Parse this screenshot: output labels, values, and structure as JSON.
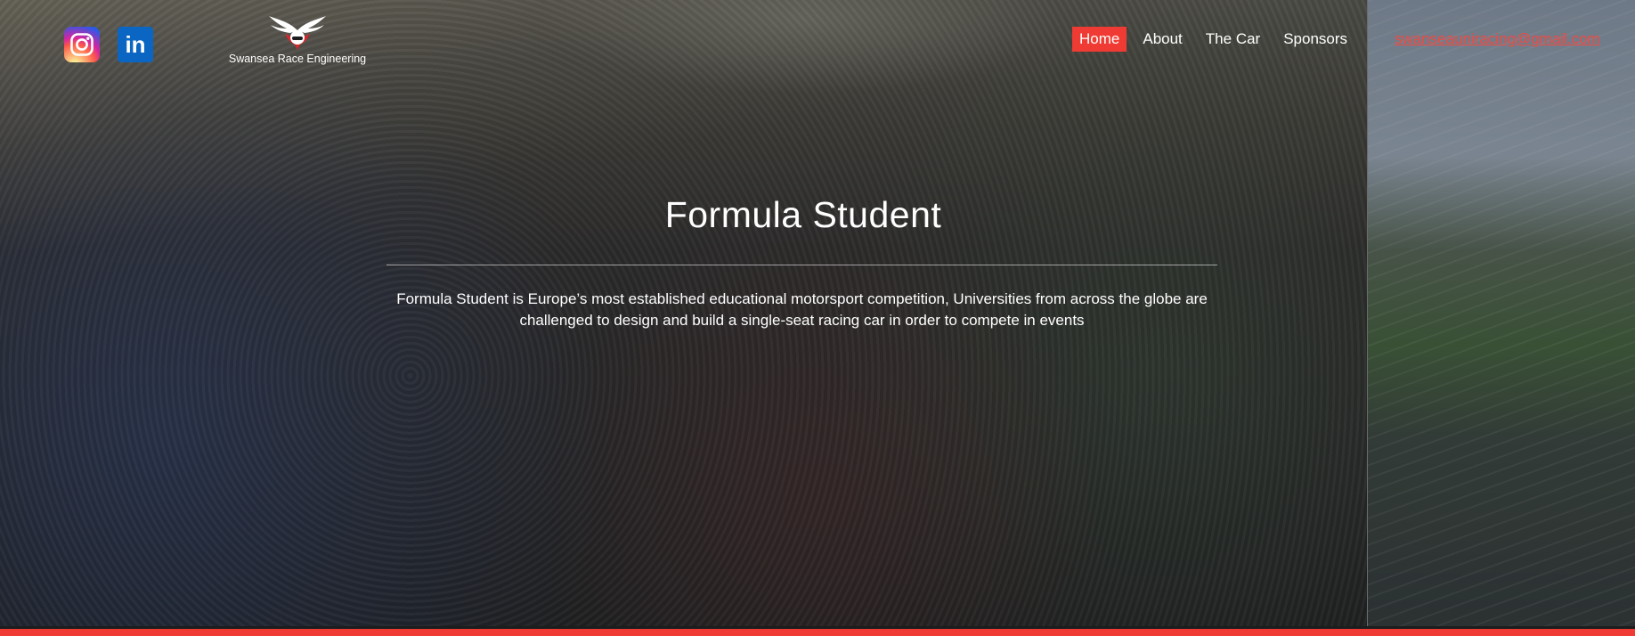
{
  "header": {
    "social": [
      {
        "name": "instagram-icon"
      },
      {
        "name": "linkedin-icon",
        "glyph": "in"
      }
    ],
    "logo_text": "Swansea Race Engineering",
    "nav": [
      {
        "label": "Home",
        "active": true
      },
      {
        "label": "About",
        "active": false
      },
      {
        "label": "The Car",
        "active": false
      },
      {
        "label": "Sponsors",
        "active": false
      }
    ],
    "email": "swanseauniracing@gmail.com"
  },
  "hero": {
    "title": "Formula Student",
    "description": "Formula Student is Europe’s most established educational motorsport competition, Universities from across the globe are challenged to design and build a single-seat racing car in order to compete in events"
  },
  "colors": {
    "accent": "#ef3b33",
    "text": "#ffffff"
  }
}
